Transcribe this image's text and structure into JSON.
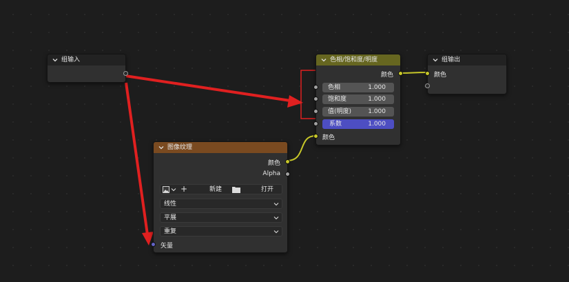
{
  "nodes": {
    "group_input": {
      "title": "组输入"
    },
    "hsv": {
      "title": "色相/饱和度/明度",
      "output_label": "颜色",
      "fields": [
        {
          "label": "色相",
          "value": "1.000"
        },
        {
          "label": "饱和度",
          "value": "1.000"
        },
        {
          "label": "值(明度)",
          "value": "1.000"
        },
        {
          "label": "系数",
          "value": "1.000"
        }
      ],
      "input_color_label": "颜色"
    },
    "group_output": {
      "title": "组输出",
      "input_label": "颜色"
    },
    "image_texture": {
      "title": "图像纹理",
      "outputs": [
        "颜色",
        "Alpha"
      ],
      "new_label": "新建",
      "open_label": "打开",
      "interpolation": "线性",
      "projection": "平展",
      "extension": "重复",
      "vector_label": "矢量"
    }
  },
  "colors": {
    "hsv_header": "#666620",
    "image_header": "#7a4a20",
    "dark_header": "#222222",
    "wire_yellow": "#c7c729",
    "arrow_red": "#e02020",
    "factor_active": "#4d4ec2"
  }
}
